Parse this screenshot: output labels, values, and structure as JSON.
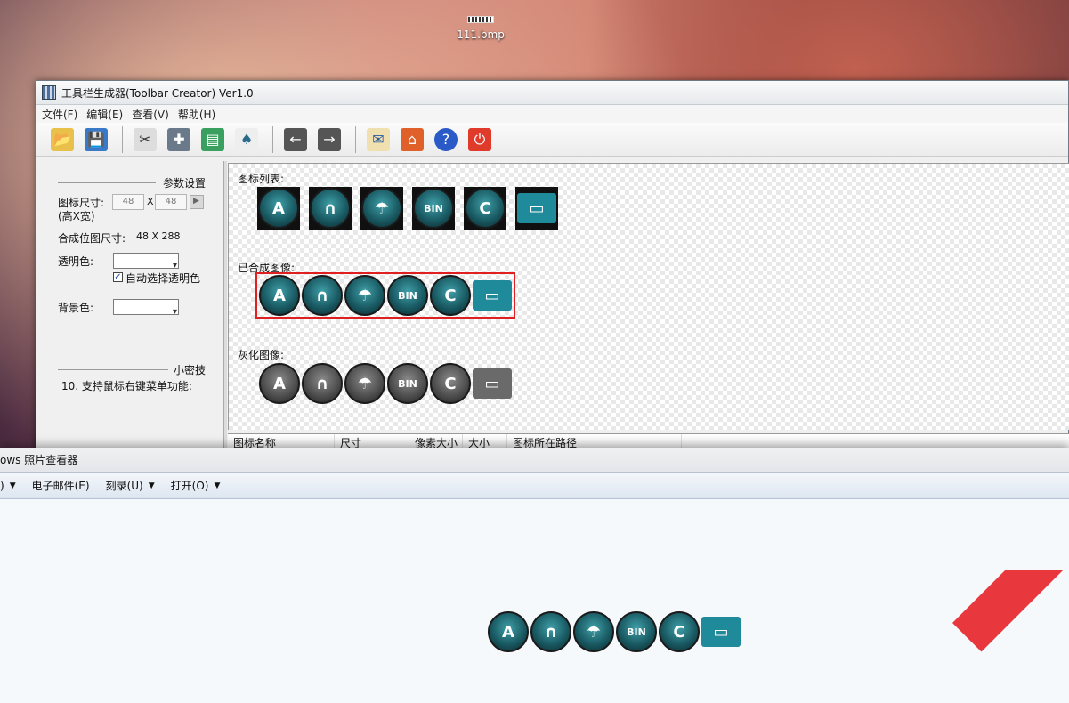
{
  "desktop": {
    "icon_label": "111.bmp"
  },
  "app": {
    "title": "工具栏生成器(Toolbar Creator) Ver1.0",
    "menu": [
      "文件(F)",
      "编辑(E)",
      "查看(V)",
      "帮助(H)"
    ],
    "toolbar": [
      {
        "name": "open-folder-icon",
        "glyph": "📂"
      },
      {
        "name": "save-icon",
        "glyph": "💾"
      },
      {
        "name": "cut-icon",
        "glyph": "✂"
      },
      {
        "name": "puzzle-icon",
        "glyph": "✚"
      },
      {
        "name": "document-icon",
        "glyph": "▤"
      },
      {
        "name": "stamp-icon",
        "glyph": "♠"
      },
      {
        "name": "arrow-left-icon",
        "glyph": "←"
      },
      {
        "name": "arrow-right-icon",
        "glyph": "→"
      },
      {
        "name": "mail-icon",
        "glyph": "✉"
      },
      {
        "name": "home-icon",
        "glyph": "⌂"
      },
      {
        "name": "help-icon",
        "glyph": "?"
      },
      {
        "name": "power-icon",
        "glyph": "⏻"
      }
    ],
    "left": {
      "params_heading": "参数设置",
      "icon_size_label": "图标尺寸:",
      "icon_size_sub": "(高X宽)",
      "height_value": "48",
      "times": "X",
      "width_value": "48",
      "composite_label": "合成位图尺寸:",
      "composite_value": "48 X 288",
      "transparent_label": "透明色:",
      "auto_transparent_label": "自动选择透明色",
      "auto_transparent_checked": true,
      "background_label": "背景色:",
      "tips_heading": "小密技",
      "tip_text": "10. 支持鼠标右键菜单功能:"
    },
    "preview": {
      "icon_list_label": "图标列表:",
      "composite_label": "已合成图像:",
      "gray_label": "灰化图像:"
    },
    "table": {
      "headers": [
        "图标名称",
        "尺寸",
        "像素大小",
        "大小",
        "图标所在路径"
      ]
    }
  },
  "viewer": {
    "title": "ows 照片查看器",
    "menu": [
      {
        "label": ")",
        "has_arrow": true
      },
      {
        "label": "电子邮件(E)",
        "has_arrow": false
      },
      {
        "label": "刻录(U)",
        "has_arrow": true
      },
      {
        "label": "打开(O)",
        "has_arrow": true
      }
    ]
  },
  "icons": [
    {
      "name": "a-letter-icon",
      "glyph": "A"
    },
    {
      "name": "headphones-icon",
      "glyph": "∩"
    },
    {
      "name": "umbrella-icon",
      "glyph": "☂"
    },
    {
      "name": "bin-disc-icon",
      "glyph": "BIN"
    },
    {
      "name": "c-brush-icon",
      "glyph": "C"
    },
    {
      "name": "monitor-icon",
      "glyph": "▭"
    }
  ],
  "colors": {
    "accent_red": "#e02020",
    "teal": "#1a5b64"
  }
}
